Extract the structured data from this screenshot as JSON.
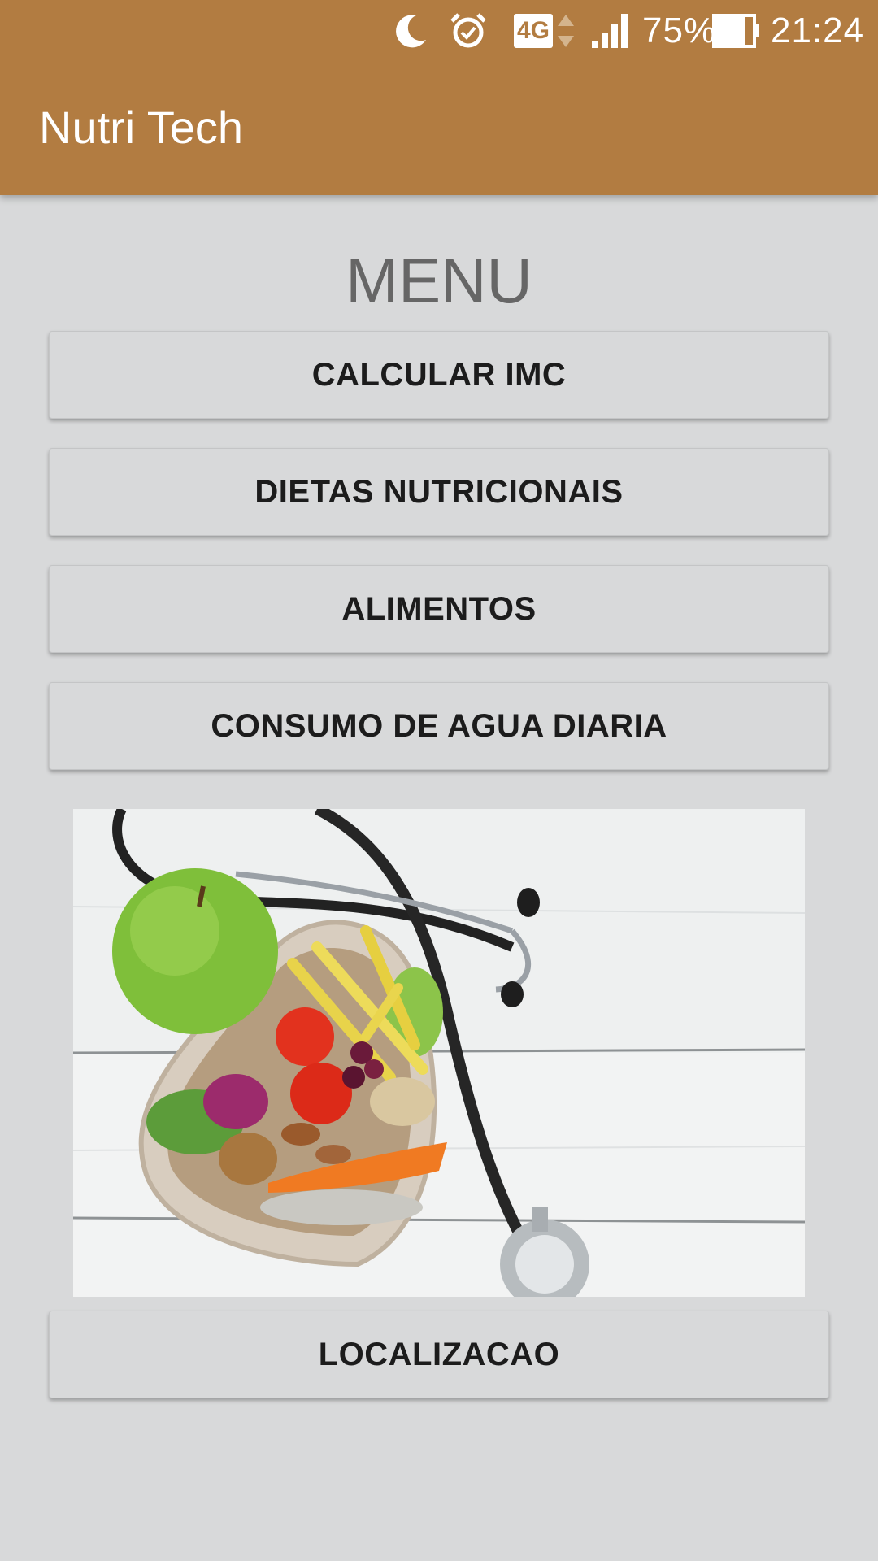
{
  "status_bar": {
    "network": "4G",
    "battery": "75%",
    "time": "21:24",
    "icons": [
      "moon-icon",
      "alarm-icon",
      "signal-icon",
      "battery-icon"
    ]
  },
  "app_bar": {
    "title": "Nutri Tech",
    "color": "#b27c41"
  },
  "menu": {
    "title": "MENU",
    "buttons": [
      "CALCULAR IMC",
      "DIETAS NUTRICIONAIS",
      "ALIMENTOS",
      "CONSUMO DE AGUA DIARIA"
    ],
    "location_button": "LOCALIZACAO"
  },
  "image": {
    "icon": "healthy-food-heart-stethoscope-image"
  }
}
